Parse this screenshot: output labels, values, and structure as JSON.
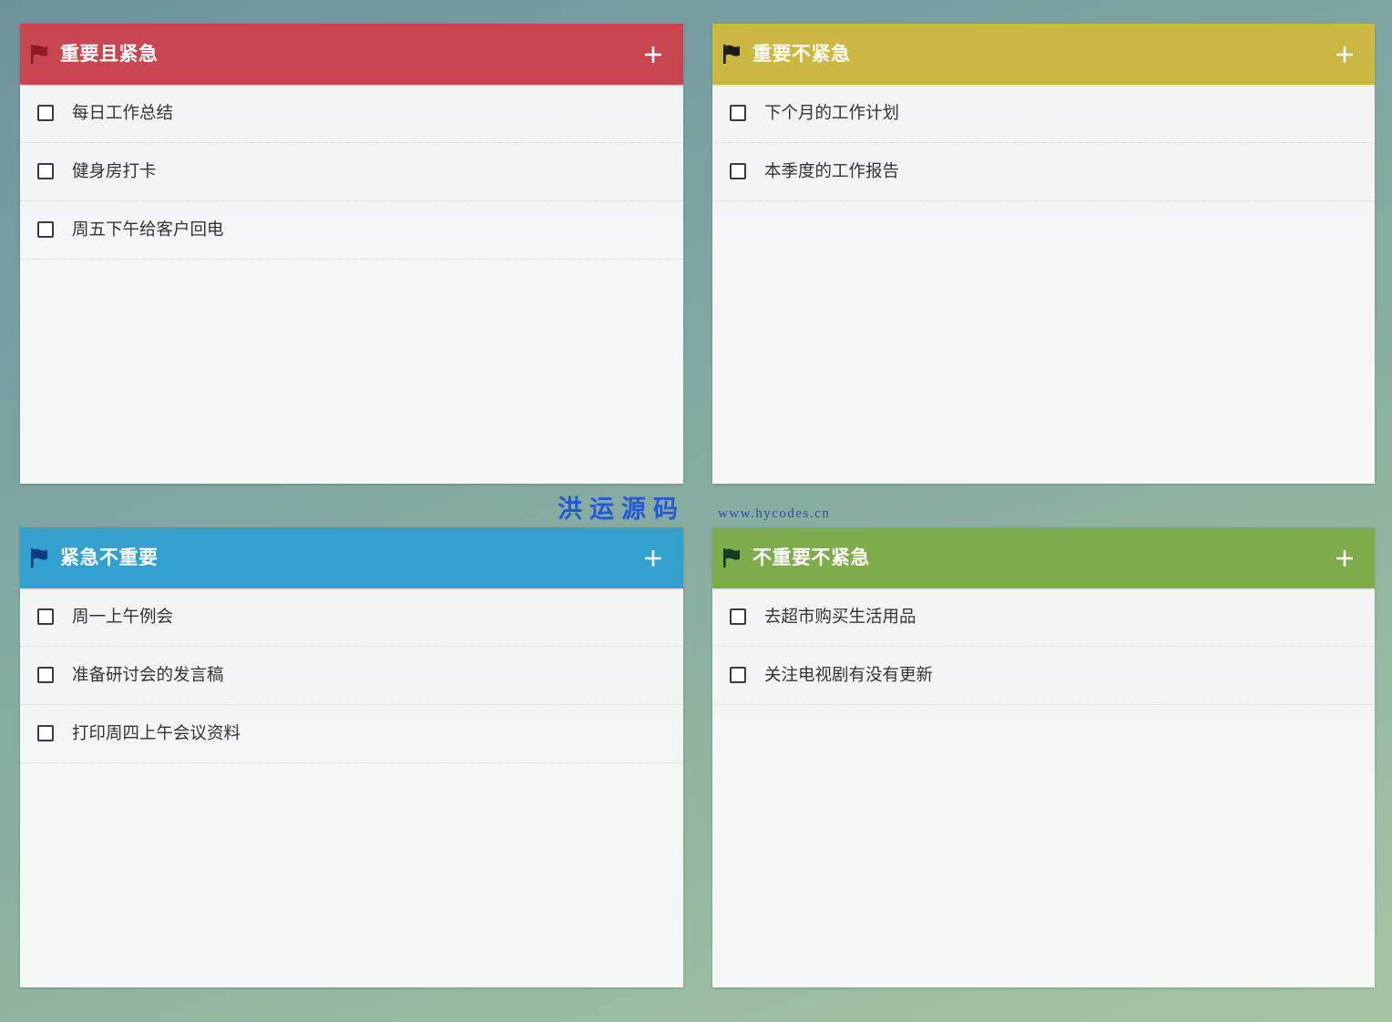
{
  "quadrants": [
    {
      "title": "重要且紧急",
      "header_color": "#c8464f",
      "flag_color": "#8e1c1c",
      "flag_icon": "flag-icon",
      "add_icon": "plus-icon",
      "tasks": [
        {
          "text": "每日工作总结",
          "checked": false
        },
        {
          "text": "健身房打卡",
          "checked": false
        },
        {
          "text": "周五下午给客户回电",
          "checked": false
        }
      ]
    },
    {
      "title": "重要不紧急",
      "header_color": "#cbb842",
      "flag_color": "#1c1c1c",
      "flag_icon": "flag-icon",
      "add_icon": "plus-icon",
      "tasks": [
        {
          "text": "下个月的工作计划",
          "checked": false
        },
        {
          "text": "本季度的工作报告",
          "checked": false
        }
      ]
    },
    {
      "title": "紧急不重要",
      "header_color": "#33a1d0",
      "flag_color": "#0d3a80",
      "flag_icon": "flag-icon",
      "add_icon": "plus-icon",
      "tasks": [
        {
          "text": "周一上午例会",
          "checked": false
        },
        {
          "text": "准备研讨会的发言稿",
          "checked": false
        },
        {
          "text": "打印周四上午会议资料",
          "checked": false
        }
      ]
    },
    {
      "title": "不重要不紧急",
      "header_color": "#7fac4a",
      "flag_color": "#113d20",
      "flag_icon": "flag-icon",
      "add_icon": "plus-icon",
      "tasks": [
        {
          "text": "去超市购买生活用品",
          "checked": false
        },
        {
          "text": "关注电视剧有没有更新",
          "checked": false
        }
      ]
    }
  ],
  "watermark": {
    "brand": "洪运源码",
    "brand_color": "#2459d8",
    "url": "www.hycodes.cn",
    "url_color": "#2a4fae"
  }
}
